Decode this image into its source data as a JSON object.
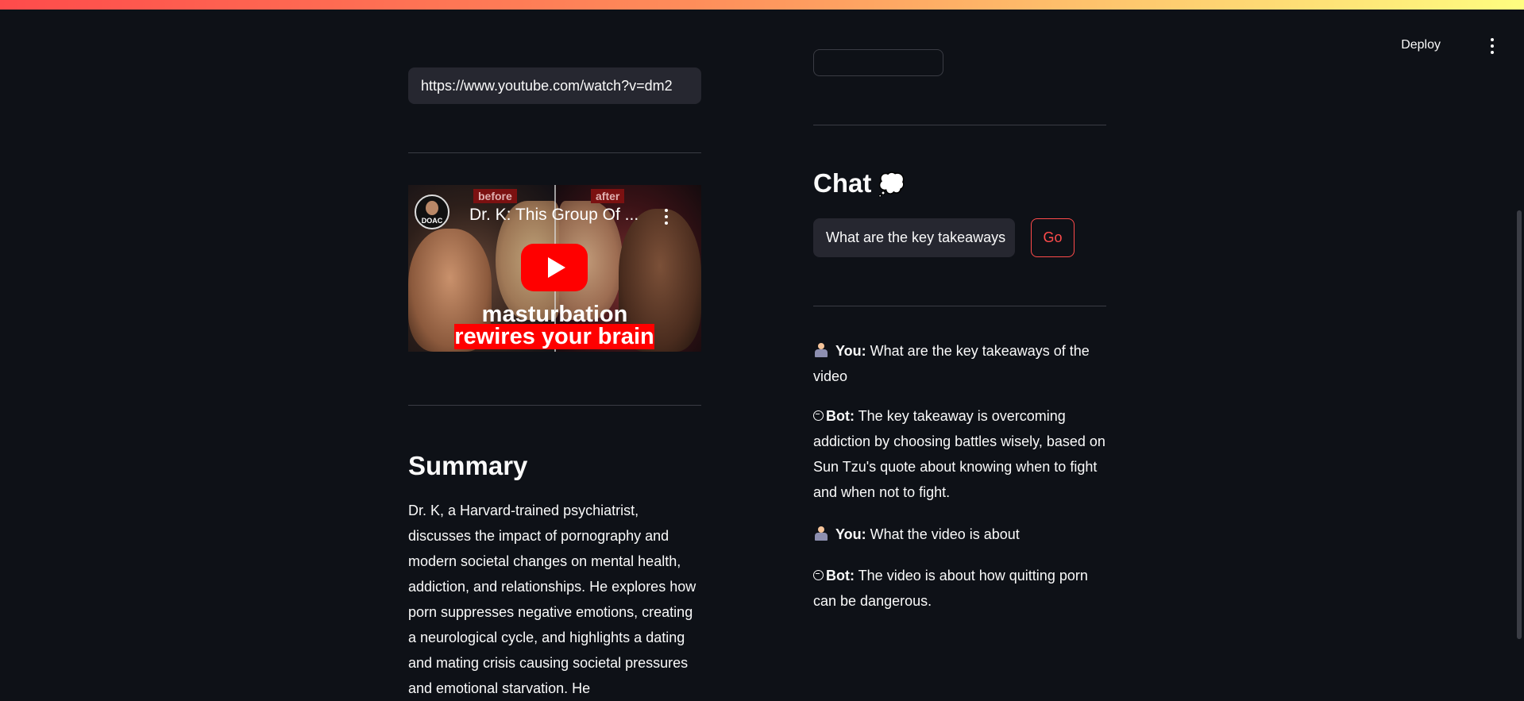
{
  "header": {
    "deploy_label": "Deploy",
    "menu_icon": "kebab-menu-icon",
    "accent_gradient": [
      "#ff4b4b",
      "#ff8c5a",
      "#fffd80"
    ]
  },
  "left": {
    "url_input_value": "https://www.youtube.com/watch?v=dm2",
    "video": {
      "title": "Dr. K: This Group Of ...",
      "channel_label": "DOAC",
      "tag_before": "before",
      "tag_after": "after",
      "caption_line1": "masturbation",
      "caption_line2": "rewires your brain"
    },
    "summary_title": "Summary",
    "summary_text": "Dr. K, a Harvard-trained psychiatrist, discusses the impact of pornography and modern societal changes on mental health, addiction, and relationships. He explores how porn suppresses negative emotions, creating a neurological cycle, and highlights a dating and mating crisis causing societal pressures and emotional starvation. He"
  },
  "right": {
    "chat_title": "Chat",
    "chat_emoji": "💭",
    "chat_input_value": "What are the key takeaways",
    "go_label": "Go",
    "messages": [
      {
        "speaker": "You:",
        "text": "What are the key takeaways of the video"
      },
      {
        "speaker": "Bot:",
        "text": "The key takeaway is overcoming addiction by choosing battles wisely, based on Sun Tzu's quote about knowing when to fight and when not to fight."
      },
      {
        "speaker": "You:",
        "text": "What the video is about"
      },
      {
        "speaker": "Bot:",
        "text": "The video is about how quitting porn can be dangerous."
      }
    ]
  },
  "colors": {
    "background": "#0e1117",
    "input_bg": "#262730",
    "primary": "#ff4b4b",
    "divider": "#3a3c44"
  }
}
